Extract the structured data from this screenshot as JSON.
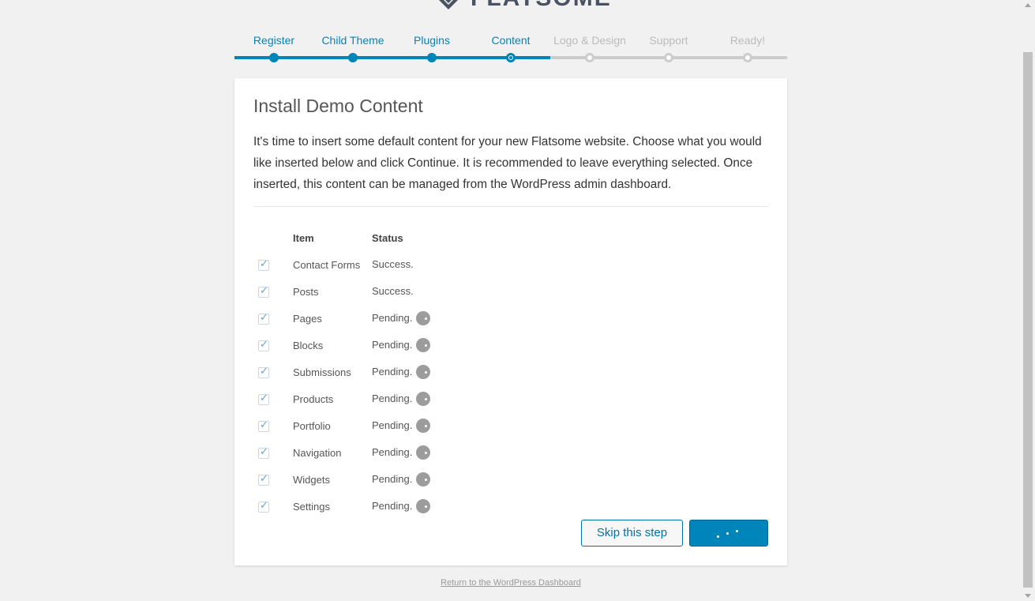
{
  "brand": {
    "logo_text": "FLATSOME",
    "accent_color": "#0085ba"
  },
  "steps": [
    {
      "label": "Register",
      "state": "done"
    },
    {
      "label": "Child Theme",
      "state": "done"
    },
    {
      "label": "Plugins",
      "state": "done"
    },
    {
      "label": "Content",
      "state": "current"
    },
    {
      "label": "Logo & Design",
      "state": "todo"
    },
    {
      "label": "Support",
      "state": "todo"
    },
    {
      "label": "Ready!",
      "state": "todo"
    }
  ],
  "main": {
    "title": "Install Demo Content",
    "intro": "It's time to insert some default content for your new Flatsome website. Choose what you would like inserted below and click Continue. It is recommended to leave everything selected. Once inserted, this content can be managed from the WordPress admin dashboard.",
    "table": {
      "headers": {
        "item": "Item",
        "status": "Status"
      },
      "rows": [
        {
          "item": "Contact Forms",
          "status": "Success.",
          "checked": true,
          "loading": false
        },
        {
          "item": "Posts",
          "status": "Success.",
          "checked": true,
          "loading": false
        },
        {
          "item": "Pages",
          "status": "Pending.",
          "checked": true,
          "loading": true
        },
        {
          "item": "Blocks",
          "status": "Pending.",
          "checked": true,
          "loading": true
        },
        {
          "item": "Submissions",
          "status": "Pending.",
          "checked": true,
          "loading": true
        },
        {
          "item": "Products",
          "status": "Pending.",
          "checked": true,
          "loading": true
        },
        {
          "item": "Portfolio",
          "status": "Pending.",
          "checked": true,
          "loading": true
        },
        {
          "item": "Navigation",
          "status": "Pending.",
          "checked": true,
          "loading": true
        },
        {
          "item": "Widgets",
          "status": "Pending.",
          "checked": true,
          "loading": true
        },
        {
          "item": "Settings",
          "status": "Pending.",
          "checked": true,
          "loading": true
        }
      ]
    },
    "buttons": {
      "skip_label": "Skip this step",
      "continue_state": "loading"
    }
  },
  "footer": {
    "dashboard_link": "Return to the WordPress Dashboard"
  }
}
